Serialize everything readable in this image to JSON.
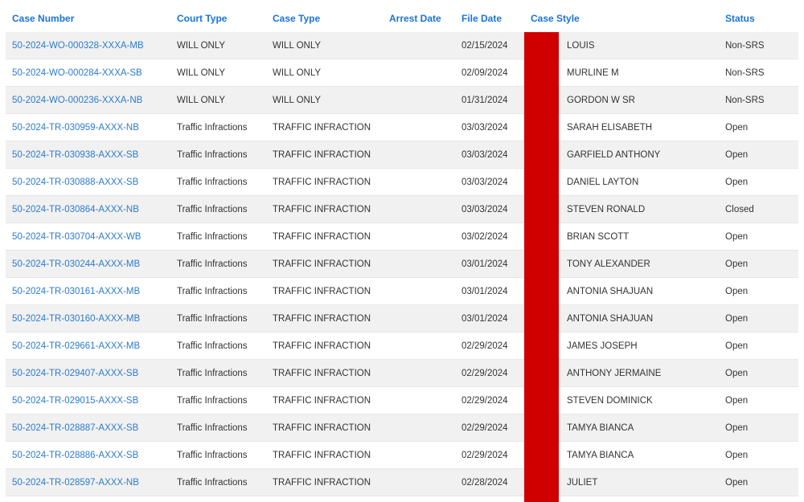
{
  "table": {
    "headers": {
      "case_number": "Case Number",
      "court_type": "Court Type",
      "case_type": "Case Type",
      "arrest_date": "Arrest Date",
      "file_date": "File Date",
      "case_style": "Case Style",
      "status": "Status"
    },
    "rows": [
      {
        "case_number": "50-2024-WO-000328-XXXA-MB",
        "court_type": "WILL ONLY",
        "case_type": "WILL ONLY",
        "arrest_date": "",
        "file_date": "02/15/2024",
        "case_style": "LOUIS",
        "status": "Non-SRS"
      },
      {
        "case_number": "50-2024-WO-000284-XXXA-SB",
        "court_type": "WILL ONLY",
        "case_type": "WILL ONLY",
        "arrest_date": "",
        "file_date": "02/09/2024",
        "case_style": "MURLINE M",
        "status": "Non-SRS"
      },
      {
        "case_number": "50-2024-WO-000236-XXXA-NB",
        "court_type": "WILL ONLY",
        "case_type": "WILL ONLY",
        "arrest_date": "",
        "file_date": "01/31/2024",
        "case_style": "GORDON W SR",
        "status": "Non-SRS"
      },
      {
        "case_number": "50-2024-TR-030959-AXXX-NB",
        "court_type": "Traffic Infractions",
        "case_type": "TRAFFIC INFRACTION",
        "arrest_date": "",
        "file_date": "03/03/2024",
        "case_style": "SARAH ELISABETH",
        "status": "Open"
      },
      {
        "case_number": "50-2024-TR-030938-AXXX-SB",
        "court_type": "Traffic Infractions",
        "case_type": "TRAFFIC INFRACTION",
        "arrest_date": "",
        "file_date": "03/03/2024",
        "case_style": "GARFIELD ANTHONY",
        "status": "Open"
      },
      {
        "case_number": "50-2024-TR-030888-AXXX-SB",
        "court_type": "Traffic Infractions",
        "case_type": "TRAFFIC INFRACTION",
        "arrest_date": "",
        "file_date": "03/03/2024",
        "case_style": "DANIEL LAYTON",
        "status": "Open"
      },
      {
        "case_number": "50-2024-TR-030864-AXXX-NB",
        "court_type": "Traffic Infractions",
        "case_type": "TRAFFIC INFRACTION",
        "arrest_date": "",
        "file_date": "03/03/2024",
        "case_style": "STEVEN RONALD",
        "status": "Closed"
      },
      {
        "case_number": "50-2024-TR-030704-AXXX-WB",
        "court_type": "Traffic Infractions",
        "case_type": "TRAFFIC INFRACTION",
        "arrest_date": "",
        "file_date": "03/02/2024",
        "case_style": "BRIAN SCOTT",
        "status": "Open"
      },
      {
        "case_number": "50-2024-TR-030244-AXXX-MB",
        "court_type": "Traffic Infractions",
        "case_type": "TRAFFIC INFRACTION",
        "arrest_date": "",
        "file_date": "03/01/2024",
        "case_style": "TONY ALEXANDER",
        "status": "Open"
      },
      {
        "case_number": "50-2024-TR-030161-AXXX-MB",
        "court_type": "Traffic Infractions",
        "case_type": "TRAFFIC INFRACTION",
        "arrest_date": "",
        "file_date": "03/01/2024",
        "case_style": "ANTONIA SHAJUAN",
        "status": "Open"
      },
      {
        "case_number": "50-2024-TR-030160-AXXX-MB",
        "court_type": "Traffic Infractions",
        "case_type": "TRAFFIC INFRACTION",
        "arrest_date": "",
        "file_date": "03/01/2024",
        "case_style": "ANTONIA SHAJUAN",
        "status": "Open"
      },
      {
        "case_number": "50-2024-TR-029661-AXXX-MB",
        "court_type": "Traffic Infractions",
        "case_type": "TRAFFIC INFRACTION",
        "arrest_date": "",
        "file_date": "02/29/2024",
        "case_style": "JAMES JOSEPH",
        "status": "Open"
      },
      {
        "case_number": "50-2024-TR-029407-AXXX-SB",
        "court_type": "Traffic Infractions",
        "case_type": "TRAFFIC INFRACTION",
        "arrest_date": "",
        "file_date": "02/29/2024",
        "case_style": "ANTHONY JERMAINE",
        "status": "Open"
      },
      {
        "case_number": "50-2024-TR-029015-AXXX-SB",
        "court_type": "Traffic Infractions",
        "case_type": "TRAFFIC INFRACTION",
        "arrest_date": "",
        "file_date": "02/29/2024",
        "case_style": "STEVEN DOMINICK",
        "status": "Open"
      },
      {
        "case_number": "50-2024-TR-028887-AXXX-SB",
        "court_type": "Traffic Infractions",
        "case_type": "TRAFFIC INFRACTION",
        "arrest_date": "",
        "file_date": "02/29/2024",
        "case_style": "TAMYA BIANCA",
        "status": "Open"
      },
      {
        "case_number": "50-2024-TR-028886-AXXX-SB",
        "court_type": "Traffic Infractions",
        "case_type": "TRAFFIC INFRACTION",
        "arrest_date": "",
        "file_date": "02/29/2024",
        "case_style": "TAMYA BIANCA",
        "status": "Open"
      },
      {
        "case_number": "50-2024-TR-028597-AXXX-NB",
        "court_type": "Traffic Infractions",
        "case_type": "TRAFFIC INFRACTION",
        "arrest_date": "",
        "file_date": "02/28/2024",
        "case_style": "JULIET",
        "status": "Open"
      }
    ]
  },
  "colors": {
    "header_text": "#1a73d9",
    "link": "#2b7bd0",
    "body_text": "#333333",
    "row_stripe": "#f1f1f1",
    "redaction": "#d10000"
  }
}
